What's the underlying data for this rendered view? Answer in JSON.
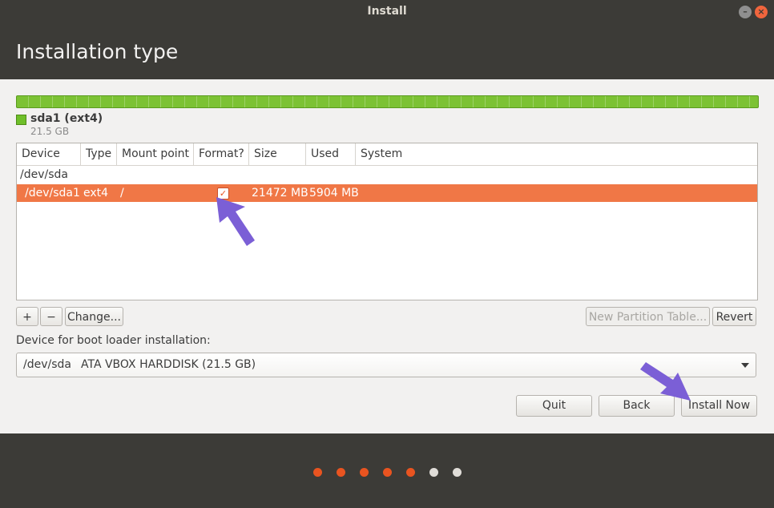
{
  "window": {
    "title": "Install",
    "minimize_glyph": "–",
    "close_glyph": "×"
  },
  "header": {
    "title": "Installation type"
  },
  "partition_legend": {
    "name": "sda1 (ext4)",
    "size": "21.5 GB",
    "color": "#7cc234"
  },
  "table": {
    "columns": [
      "Device",
      "Type",
      "Mount point",
      "Format?",
      "Size",
      "Used",
      "System"
    ],
    "device_row": "/dev/sda",
    "selected_row": {
      "device": "/dev/sda1",
      "type": "ext4",
      "mount": "/",
      "format_checked": "✓",
      "size": "21472 MB",
      "used": "5904 MB",
      "system": ""
    }
  },
  "partition_buttons": {
    "add": "+",
    "remove": "−",
    "change": "Change...",
    "new_table": "New Partition Table...",
    "revert": "Revert"
  },
  "bootloader": {
    "label": "Device for boot loader installation:",
    "selected_device": "/dev/sda",
    "selected_desc": "ATA VBOX HARDDISK (21.5 GB)"
  },
  "actions": {
    "quit": "Quit",
    "back": "Back",
    "install": "Install Now"
  },
  "progress": {
    "completed_steps": 5,
    "total_steps": 7,
    "active_color": "#e95420",
    "inactive_color": "#e0ddd8"
  },
  "colors": {
    "accent": "#f07746",
    "annotation_arrow": "#7b5fd6"
  }
}
